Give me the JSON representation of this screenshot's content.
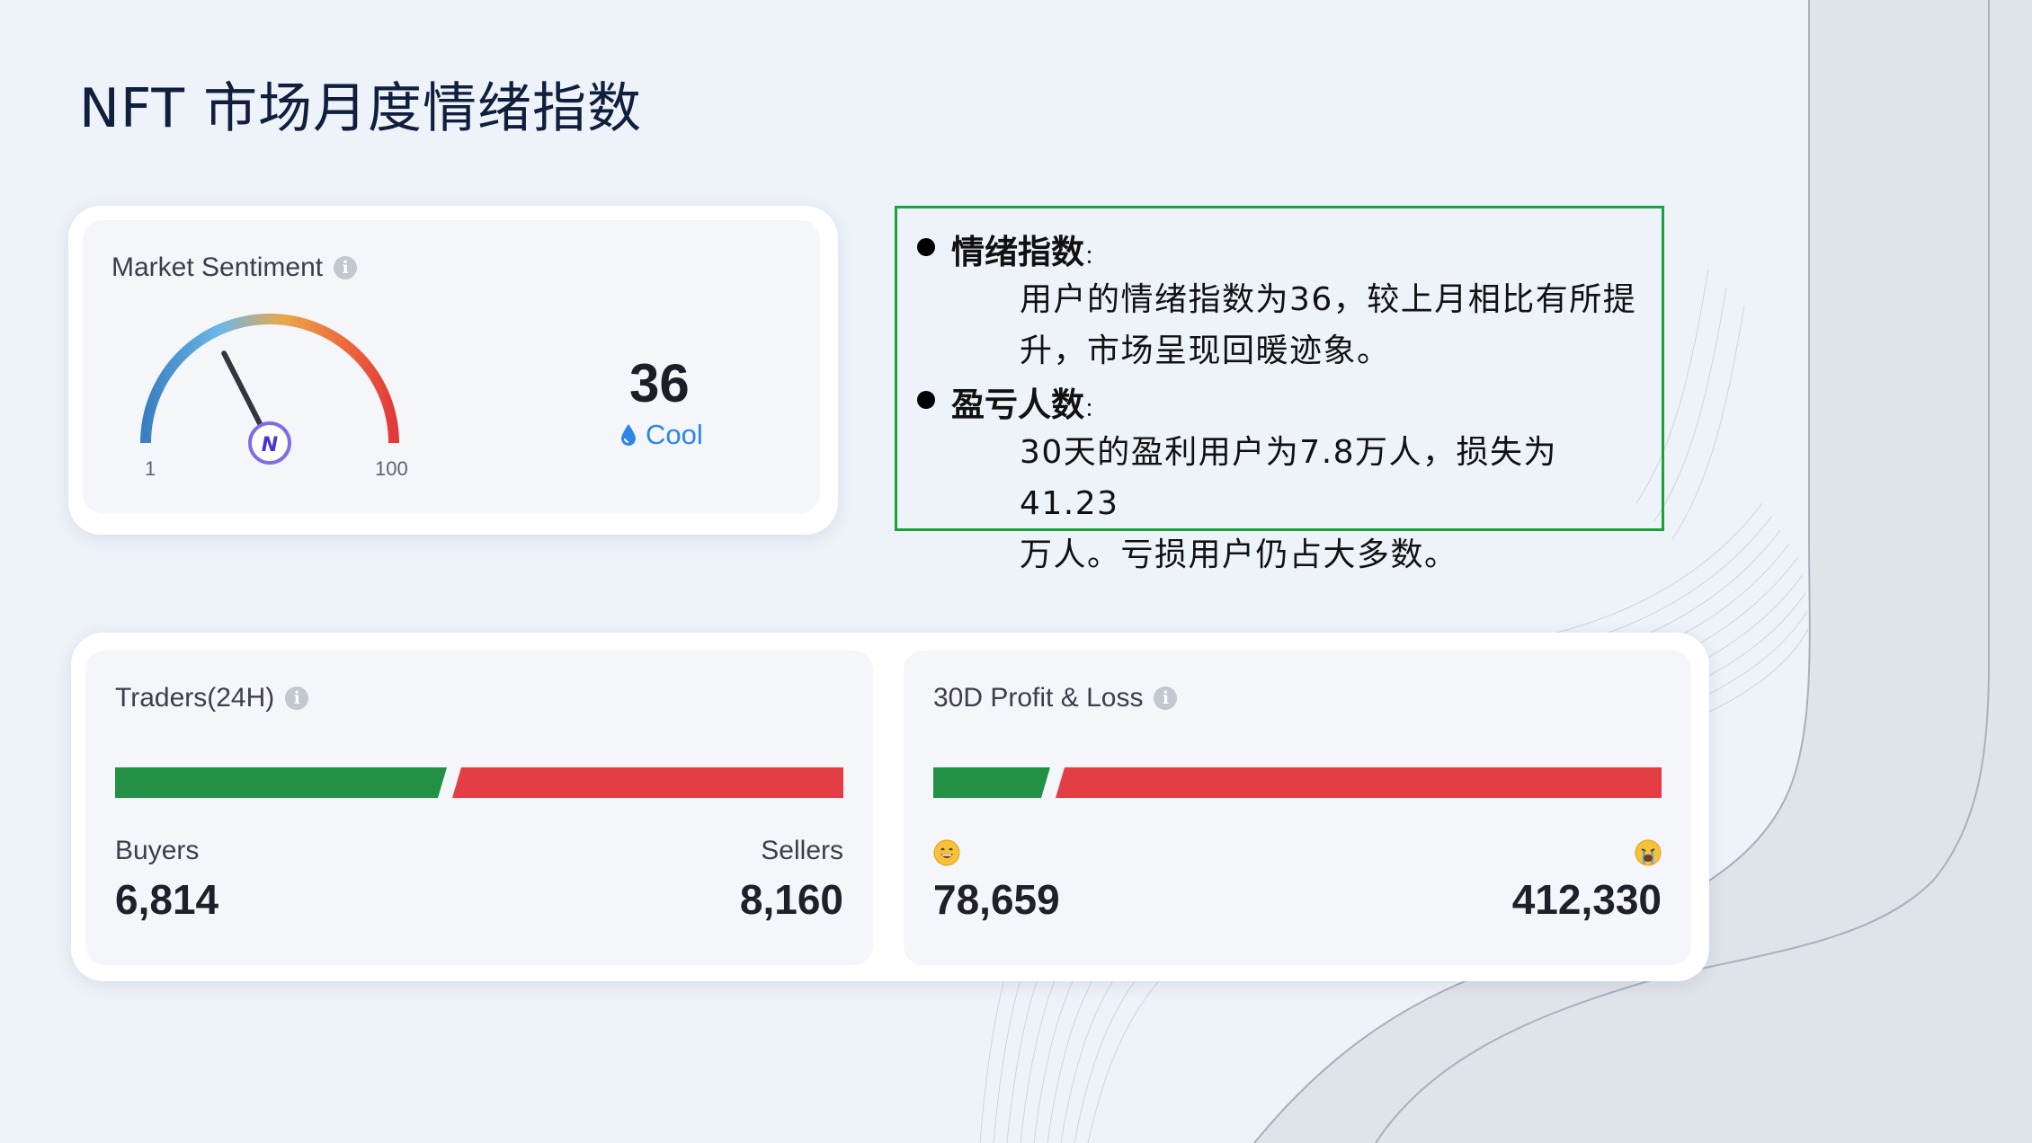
{
  "page": {
    "title": "NFT 市场月度情绪指数"
  },
  "sentiment": {
    "label": "Market Sentiment",
    "value": "36",
    "mood": "Cool",
    "scale_min": "1",
    "scale_max": "100",
    "level_fraction": 0.35
  },
  "notes": {
    "items": [
      {
        "heading": "情绪指数",
        "colon": "：",
        "lines": [
          "用户的情绪指数为36，较上月相比有所提",
          "升，市场呈现回暖迹象。"
        ]
      },
      {
        "heading": "盈亏人数",
        "colon": "：",
        "lines": [
          "30天的盈利用户为7.8万人，损失为41.23",
          "万人。亏损用户仍占大多数。"
        ]
      }
    ]
  },
  "traders": {
    "label": "Traders(24H)",
    "buyers_label": "Buyers",
    "sellers_label": "Sellers",
    "buyers_value": "6,814",
    "sellers_value": "8,160",
    "buyers_share": 0.455
  },
  "pnl": {
    "label": "30D Profit & Loss",
    "profit_icon": "grinning-face-icon",
    "loss_icon": "crying-face-icon",
    "profit_value": "78,659",
    "loss_value": "412,330",
    "profit_share": 0.16
  },
  "colors": {
    "accent_green": "#229145",
    "accent_red": "#e43e45",
    "cool_blue": "#2d86e6",
    "note_border": "#1aa33b",
    "title": "#0f1f3d"
  }
}
